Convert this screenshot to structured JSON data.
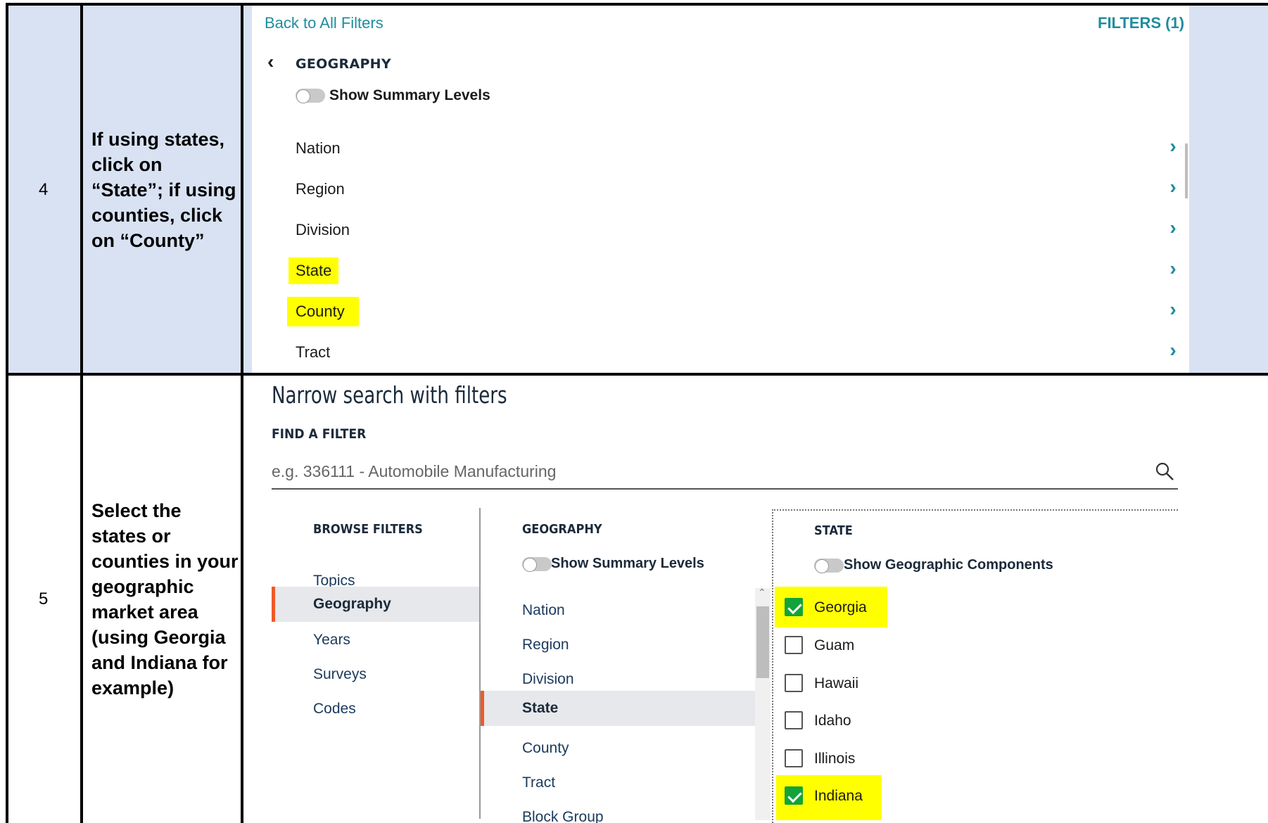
{
  "steps": [
    {
      "number": "4",
      "instruction": "If using states, click on “State”; if using counties, click on “County”"
    },
    {
      "number": "5",
      "instruction": "Select the states or counties in your geographic market area (using Georgia and Indiana for example)"
    }
  ],
  "geo_panel": {
    "back_link": "Back to All Filters",
    "filters_count": "FILTERS (1)",
    "header": "GEOGRAPHY",
    "toggle_label": "Show Summary Levels",
    "items": [
      "Nation",
      "Region",
      "Division",
      "State",
      "County",
      "Tract"
    ],
    "highlighted": [
      "State",
      "County"
    ]
  },
  "filter_panel": {
    "title": "Narrow search with filters",
    "find_label": "FIND A FILTER",
    "search_placeholder": "e.g. 336111 - Automobile Manufacturing",
    "browse": {
      "header": "BROWSE FILTERS",
      "items": [
        "Topics",
        "Geography",
        "Years",
        "Surveys",
        "Codes"
      ],
      "selected": "Geography"
    },
    "geography": {
      "header": "GEOGRAPHY",
      "toggle_label": "Show Summary Levels",
      "items": [
        "Nation",
        "Region",
        "Division",
        "State",
        "County",
        "Tract",
        "Block Group"
      ],
      "selected": "State"
    },
    "state": {
      "header": "STATE",
      "toggle_label": "Show Geographic Components",
      "options": [
        {
          "label": "Georgia",
          "checked": true
        },
        {
          "label": "Guam",
          "checked": false
        },
        {
          "label": "Hawaii",
          "checked": false
        },
        {
          "label": "Idaho",
          "checked": false
        },
        {
          "label": "Illinois",
          "checked": false
        },
        {
          "label": "Indiana",
          "checked": true
        }
      ]
    }
  },
  "colors": {
    "accent": "#1f8d9e",
    "highlight": "#ffff00",
    "selected_bar": "#f05a28",
    "check": "#12a33b",
    "row_bg": "#d9e2f3"
  }
}
